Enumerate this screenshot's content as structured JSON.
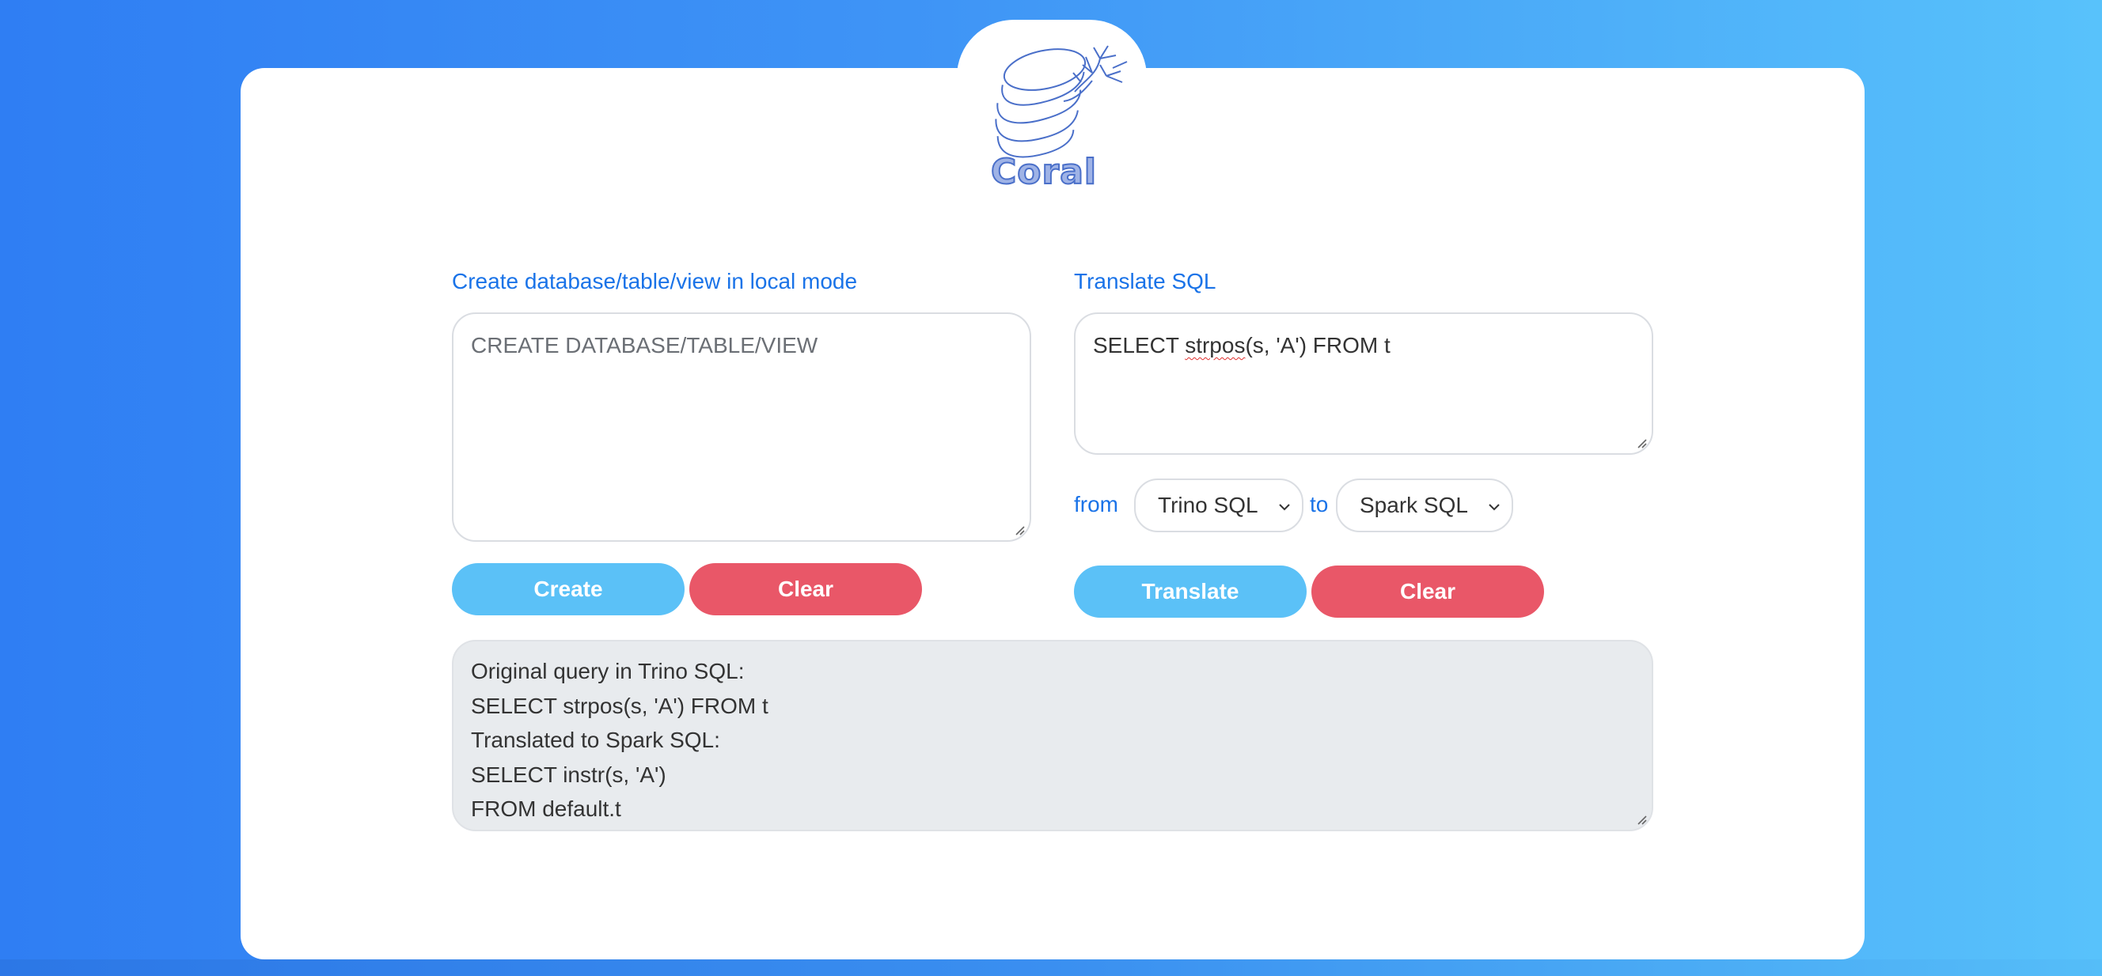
{
  "brand": {
    "name": "Coral",
    "logo_icon": "coral-database-icon"
  },
  "create_section": {
    "label": "Create database/table/view in local mode",
    "placeholder": "CREATE DATABASE/TABLE/VIEW",
    "value": "",
    "create_button": "Create",
    "clear_button": "Clear"
  },
  "translate_section": {
    "label": "Translate SQL",
    "query_prefix": "SELECT ",
    "query_misspelled": "strpos",
    "query_suffix": "(s, 'A') FROM t",
    "from_label": "from",
    "from_selected": "Trino SQL",
    "to_label": "to",
    "to_selected": "Spark SQL",
    "translate_button": "Translate",
    "clear_button": "Clear"
  },
  "output": {
    "lines": [
      "Original query in Trino SQL:",
      "SELECT strpos(s, 'A') FROM t",
      "Translated to Spark SQL:",
      "SELECT instr(s, 'A')",
      "FROM default.t"
    ]
  },
  "colors": {
    "accent": "#1a73e8",
    "primary_button": "#5bc1f7",
    "danger_button": "#e95768",
    "output_bg": "#e8ebee"
  }
}
